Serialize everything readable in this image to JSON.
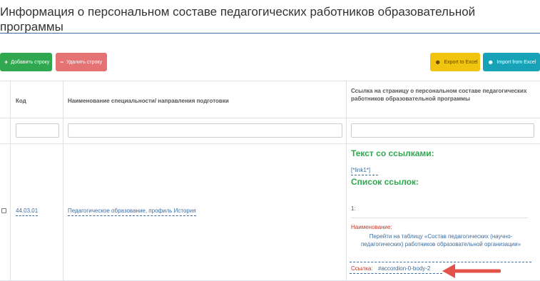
{
  "page": {
    "title": "Информация о персональном составе педагогических работников образовательной программы"
  },
  "toolbar": {
    "add_label": "Добавить строку",
    "delete_label": "Удалить строку",
    "export_label": "Export to Excel",
    "import_label": "Import from Excel"
  },
  "table": {
    "columns": [
      "Код",
      "Наименование специальности/ направления подготовки",
      "Ссылка на страницу о персональном составе педагогических работников образовательной программы"
    ],
    "rows": [
      {
        "code": "44.03.01",
        "name": "Педагогическое образование, профиль История",
        "links_cell": {
          "text_heading": "Текст со ссылками:",
          "link_token": "[*link1*]",
          "list_heading": "Список ссылок:",
          "item_number": "1:",
          "name_label": "Наименование:",
          "name_value": "Перейти на таблицу «Состав педагогических (научно-педагогических) работников образовательной организации»",
          "url_label": "Ссылка:",
          "url_value": "#accordion-0-body-2"
        }
      }
    ]
  },
  "colors": {
    "accent": "#3c6d9e",
    "add": "#2fa84f",
    "delete": "#e57373",
    "export": "#f1c40f",
    "import": "#17a2b8",
    "annotation_arrow": "#e2534a"
  }
}
